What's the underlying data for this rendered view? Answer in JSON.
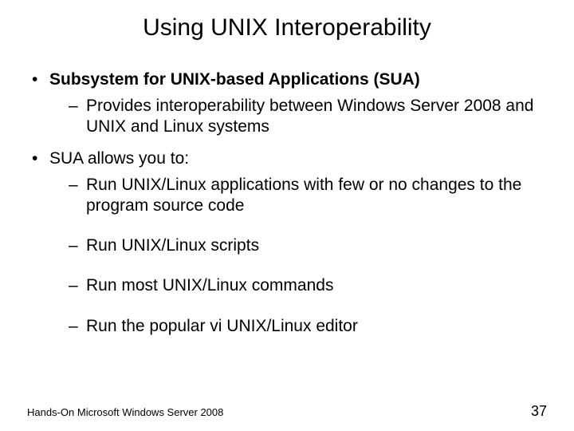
{
  "title": "Using UNIX Interoperability",
  "bullets": [
    {
      "text": "Subsystem for UNIX-based Applications (SUA)",
      "bold": true,
      "sub": [
        "Provides interoperability between Windows Server 2008 and UNIX and Linux systems"
      ]
    },
    {
      "text": "SUA allows you to:",
      "bold": false,
      "sub": [
        "Run UNIX/Linux applications with few or no changes to the program source code",
        "Run UNIX/Linux scripts",
        "Run most UNIX/Linux commands",
        "Run the popular vi UNIX/Linux editor"
      ]
    }
  ],
  "footer": {
    "left": "Hands-On Microsoft Windows Server 2008",
    "right": "37"
  }
}
